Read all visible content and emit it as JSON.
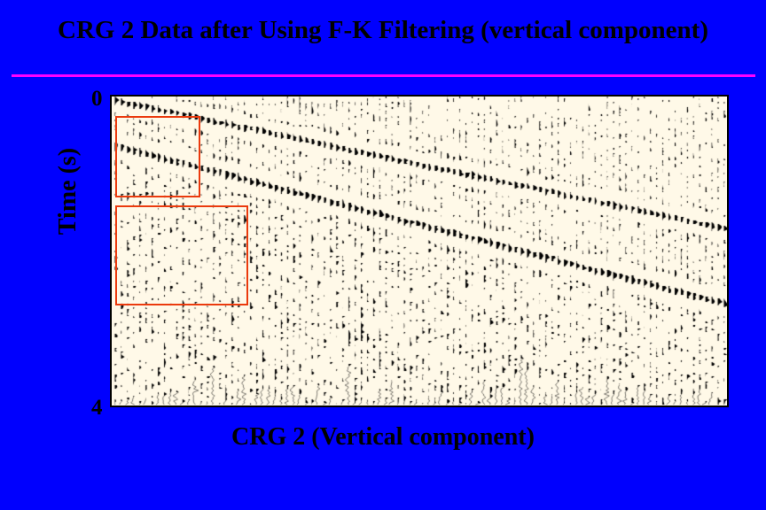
{
  "title": "CRG 2 Data after Using F-K Filtering (vertical component)",
  "yaxis_label": "Time  (s)",
  "ytick_top": "0",
  "ytick_bottom": "4",
  "xaxis_label": "CRG 2 (Vertical component)",
  "chart_data": {
    "type": "heatmap",
    "title": "CRG 2 Data after Using F-K Filtering (vertical component)",
    "xlabel": "CRG 2 (Vertical component)",
    "ylabel": "Time (s)",
    "ylim": [
      0,
      4
    ],
    "y_unit": "s",
    "description": "Common-receiver-gather wiggle-trace seismic section (vertical geophone component) after F-K dip filtering. Vertical axis is two-way time 0–4 s increasing downward; horizontal axis is trace index (offset increasing to the right). Dominant down-going first arrival sweeps from ~0 s at left edge to ~1.7 s at right edge. A second coherent event is visible sweeping from ~0.6 s at left to ~2.7 s at right. Below the events the section is dominated by residual noise / ringing.",
    "highlighted_regions": [
      {
        "name": "upper-red-box",
        "approx_trace_fraction": [
          0.0,
          0.14
        ],
        "approx_time_s": [
          0.25,
          1.3
        ]
      },
      {
        "name": "lower-red-box",
        "approx_trace_fraction": [
          0.0,
          0.22
        ],
        "approx_time_s": [
          1.4,
          2.7
        ]
      }
    ]
  }
}
